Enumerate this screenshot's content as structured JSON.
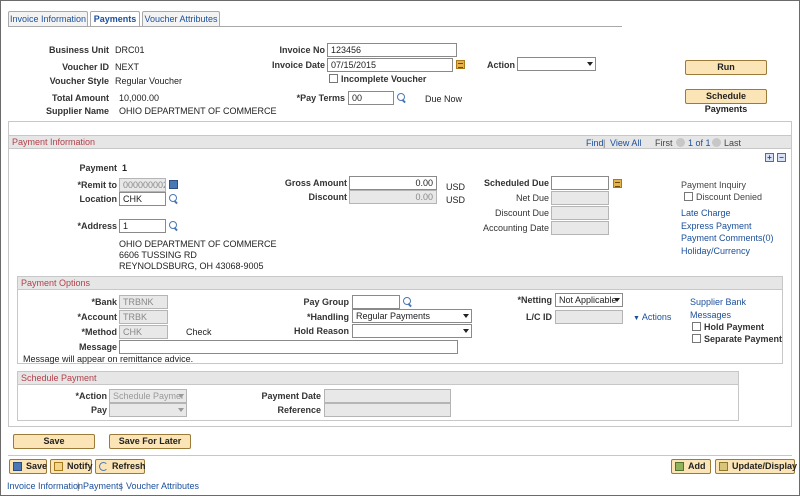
{
  "tabs": [
    "Invoice Information",
    "Payments",
    "Voucher Attributes"
  ],
  "header": {
    "business_unit_label": "Business Unit",
    "business_unit": "DRC01",
    "voucher_id_label": "Voucher ID",
    "voucher_id": "NEXT",
    "voucher_style_label": "Voucher Style",
    "voucher_style": "Regular Voucher",
    "total_amount_label": "Total Amount",
    "total_amount": "10,000.00",
    "supplier_name_label": "Supplier Name",
    "supplier_name": "OHIO DEPARTMENT OF COMMERCE",
    "invoice_no_label": "Invoice No",
    "invoice_no": "123456",
    "invoice_date_label": "Invoice Date",
    "invoice_date": "07/15/2015",
    "incomplete_voucher_label": "Incomplete Voucher",
    "pay_terms_label": "*Pay Terms",
    "pay_terms": "00",
    "pay_terms_desc": "Due Now",
    "action_label": "Action",
    "action_value": "",
    "run_label": "Run",
    "schedule_payments_label": "Schedule Payments"
  },
  "payment_info": {
    "title": "Payment Information",
    "nav_find": "Find",
    "nav_sep": "|",
    "nav_view_all": "View All",
    "nav_first": "First",
    "nav_count": "1 of 1",
    "nav_last": "Last",
    "payment_label": "Payment",
    "payment_no": "1",
    "remit_to_label": "*Remit to",
    "remit_to": "0000000024",
    "location_label": "Location",
    "location": "CHK",
    "address_label": "*Address",
    "address_no": "1",
    "address_lines": [
      "OHIO DEPARTMENT OF COMMERCE",
      "6606 TUSSING RD",
      "REYNOLDSBURG, OH  43068-9005"
    ],
    "gross_amount_label": "Gross Amount",
    "gross_amount": "0.00",
    "discount_label": "Discount",
    "discount": "0.00",
    "currency": "USD",
    "scheduled_due_label": "Scheduled Due",
    "net_due_label": "Net Due",
    "discount_due_label": "Discount Due",
    "accounting_date_label": "Accounting Date",
    "payment_inquiry_label": "Payment Inquiry",
    "discount_denied_label": "Discount Denied",
    "links": [
      "Late Charge",
      "Express Payment",
      "Payment Comments(0)",
      "Holiday/Currency"
    ]
  },
  "payment_options": {
    "title": "Payment Options",
    "bank_label": "*Bank",
    "bank": "TRBNK",
    "account_label": "*Account",
    "account": "TRBK",
    "method_label": "*Method",
    "method": "CHK",
    "method_desc": "Check",
    "message_label": "Message",
    "message_note": "Message will appear on remittance advice.",
    "pay_group_label": "Pay Group",
    "handling_label": "*Handling",
    "handling": "Regular Payments",
    "hold_reason_label": "Hold Reason",
    "netting_label": "*Netting",
    "netting": "Not Applicable",
    "lc_id_label": "L/C ID",
    "actions_label": "Actions",
    "supplier_bank_label": "Supplier Bank",
    "messages_label": "Messages",
    "hold_payment_label": "Hold Payment",
    "separate_payment_label": "Separate Payment"
  },
  "schedule_payment": {
    "title": "Schedule Payment",
    "action_label": "*Action",
    "action_value": "Schedule Paymer",
    "pay_label": "Pay",
    "payment_date_label": "Payment Date",
    "reference_label": "Reference"
  },
  "buttons": {
    "save": "Save",
    "save_for_later": "Save For Later"
  },
  "toolbar": {
    "save": "Save",
    "notify": "Notify",
    "refresh": "Refresh",
    "add": "Add",
    "update_display": "Update/Display"
  },
  "footer_links": [
    "Invoice Information",
    "Payments",
    "Voucher Attributes"
  ],
  "footer_sep": "|",
  "icons": {
    "lookup": "magnifier-icon",
    "calendar": "calendar-icon",
    "prompt": "prompt-icon",
    "add_row": "plus-icon",
    "delete_row": "minus-icon"
  }
}
